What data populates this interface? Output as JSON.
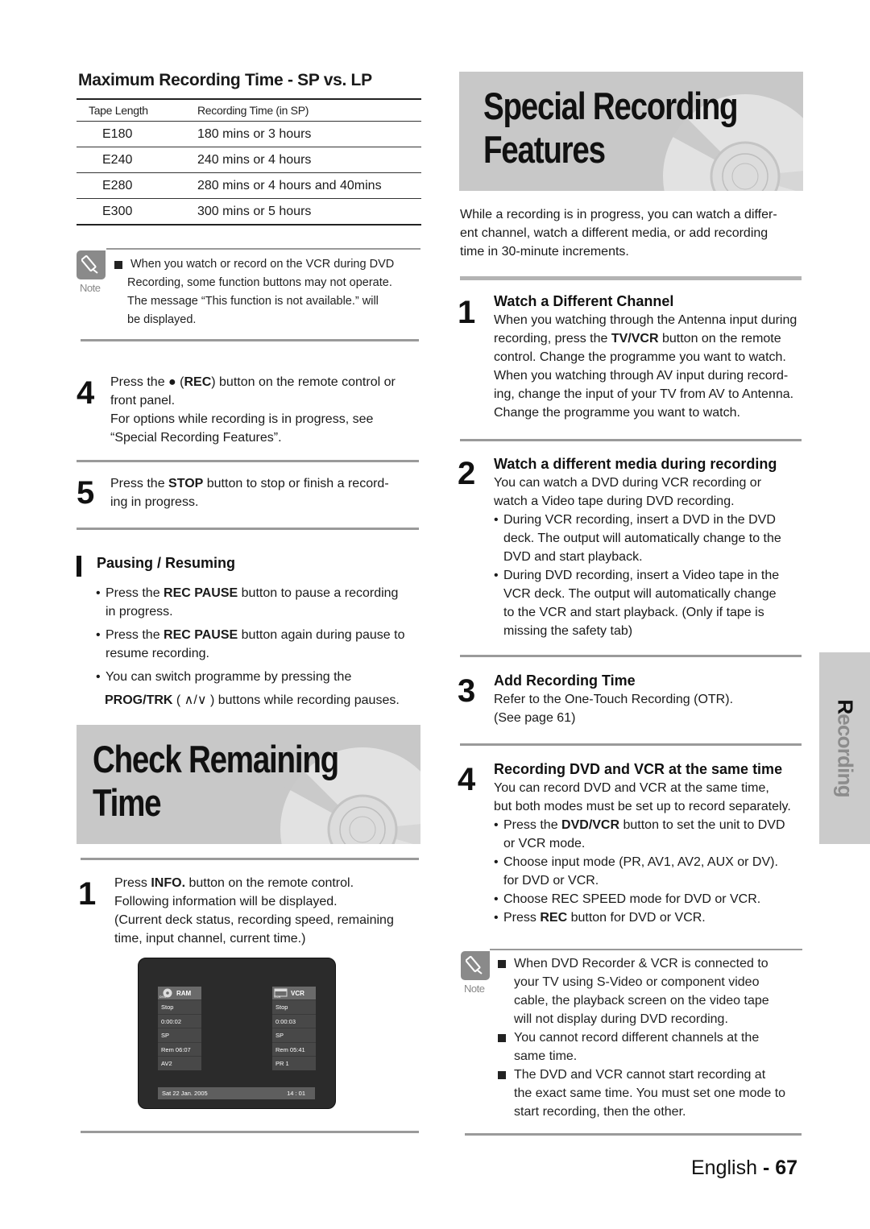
{
  "left": {
    "max_rec": {
      "heading": "Maximum Recording Time - SP vs. LP",
      "columns": [
        "Tape Length",
        "Recording Time (in SP)"
      ],
      "rows": [
        [
          "E180",
          "180 mins or 3 hours"
        ],
        [
          "E240",
          "240 mins or 4 hours"
        ],
        [
          "E280",
          "280 mins or 4 hours and 40mins"
        ],
        [
          "E300",
          "300 mins or 5 hours"
        ]
      ]
    },
    "note1": {
      "label": "Note",
      "items": [
        [
          "When you watch or record on the VCR during DVD",
          "Recording, some function buttons may not operate.",
          "The message “This function is not available.” will",
          "be displayed."
        ]
      ]
    },
    "step4": {
      "num": "4",
      "l1_a": "Press the ● (",
      "l1_b": "REC",
      "l1_c": ") button on the remote control or",
      "l2": "front panel.",
      "l3": "For options while recording is in progress, see",
      "l4": "“Special Recording Features”."
    },
    "step5": {
      "num": "5",
      "l1_a": "Press the ",
      "l1_b": "STOP",
      "l1_c": " button to stop or finish a record-",
      "l2": "ing in progress."
    },
    "pausing": {
      "heading": "Pausing / Resuming",
      "b1_a": "Press the ",
      "b1_b": "REC PAUSE",
      "b1_c": " button to pause a recording",
      "b1_d": "in progress.",
      "b2_a": "Press the ",
      "b2_b": "REC PAUSE",
      "b2_c": " button again during pause to",
      "b2_d": "resume recording.",
      "b3_a": "You can switch programme by pressing the",
      "b3_b": "PROG/TRK",
      "b3_c": " ( ∧/∨ ) buttons while recording pauses."
    },
    "check_banner": {
      "title": "Check Remaining Time"
    },
    "check_step1": {
      "num": "1",
      "l1_a": "Press ",
      "l1_b": "INFO.",
      "l1_c": " button on the remote control.",
      "l2": "Following information will be displayed.",
      "l3": "(Current deck status, recording speed, remaining",
      "l4": " time, input channel, current time.)"
    },
    "osd": {
      "dvd": {
        "icon_label": "DVD",
        "title": "RAM",
        "cells": [
          "Stop",
          "0:00:02",
          "SP",
          "Rem 06:07",
          "AV2"
        ]
      },
      "vcr": {
        "icon_label": "VCR",
        "title": "VCR",
        "cells": [
          "Stop",
          "0:00:03",
          "SP",
          "Rem 05:41",
          "PR 1"
        ]
      },
      "date": "Sat 22 Jan. 2005",
      "time": "14 : 01"
    }
  },
  "right": {
    "banner": {
      "title_l1": "Special Recording",
      "title_l2": "Features"
    },
    "intro": [
      "While a recording is in progress, you can watch a differ-",
      "ent channel, watch a different media, or add recording",
      "time in 30-minute increments."
    ],
    "s1": {
      "num": "1",
      "heading": "Watch a Different Channel",
      "l1": "When you watching through the Antenna input during",
      "l2_a": "recording, press the ",
      "l2_b": "TV/VCR",
      "l2_c": " button on the remote",
      "l3": "control. Change the programme you want to watch.",
      "l4": "When you watching through AV input during record-",
      "l5": "ing, change the input of your TV from AV to Antenna.",
      "l6": "Change the programme you want to watch."
    },
    "s2": {
      "num": "2",
      "heading": "Watch a different media during recording",
      "l1": "You can watch a DVD during VCR recording or",
      "l2": "watch a Video tape during DVD recording.",
      "b1": [
        "During VCR recording, insert a DVD in the DVD",
        "deck. The output will automatically change to the",
        "DVD and start playback."
      ],
      "b2": [
        "During DVD recording, insert a Video tape in the",
        "VCR deck. The output will automatically change",
        "to the VCR and start playback. (Only if tape is",
        "missing the safety tab)"
      ]
    },
    "s3": {
      "num": "3",
      "heading": "Add Recording Time",
      "l1": "Refer to the One-Touch Recording (OTR).",
      "l2": "(See page 61)"
    },
    "s4": {
      "num": "4",
      "heading": "Recording DVD and VCR at the same time",
      "l1": "You can record DVD and VCR at the same time,",
      "l2": "but both modes must be set up to record separately.",
      "b1_a": "Press the ",
      "b1_b": "DVD/VCR",
      "b1_c": " button to set the unit to DVD",
      "b1_d": "or VCR mode.",
      "b2": [
        "Choose input mode (PR, AV1, AV2, AUX or DV).",
        "for DVD or VCR."
      ],
      "b3": "Choose REC SPEED mode for DVD or VCR.",
      "b4_a": "Press ",
      "b4_b": "REC",
      "b4_c": " button for DVD or VCR."
    },
    "note2": {
      "label": "Note",
      "i1": [
        "When DVD Recorder & VCR is connected to",
        "your TV using S-Video or component video",
        "cable, the playback screen on the video tape",
        "will not display during DVD recording."
      ],
      "i2": [
        "You cannot record different channels at the",
        " same time."
      ],
      "i3": [
        "The DVD and VCR cannot start recording at",
        "the exact same time. You must set one mode to",
        "start recording, then the other."
      ]
    }
  },
  "side_tab": {
    "first": "R",
    "rest": "ecording"
  },
  "footer": {
    "lang": "English",
    "sep": " - ",
    "page": "67"
  }
}
